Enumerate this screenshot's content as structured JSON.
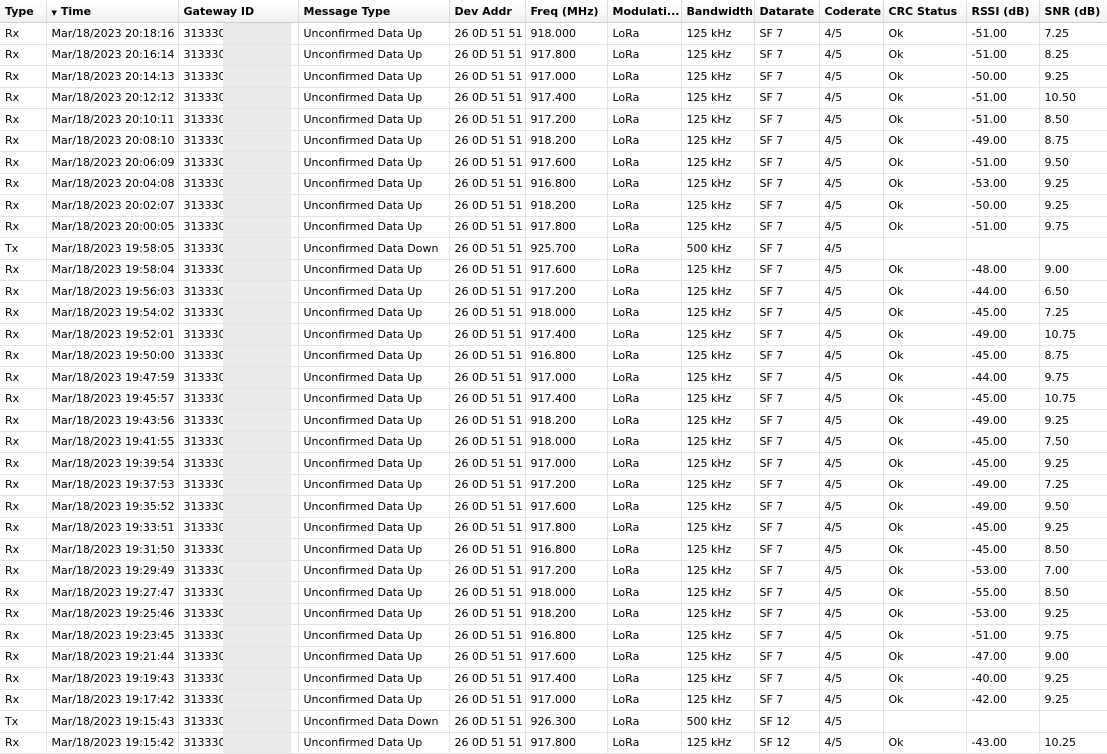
{
  "columns": [
    "Type",
    "Time",
    "Gateway ID",
    "Message Type",
    "Dev Addr",
    "Freq (MHz)",
    "Modulati...",
    "Bandwidth",
    "Datarate",
    "Coderate",
    "CRC Status",
    "RSSI (dB)",
    "SNR (dB)"
  ],
  "sort_indicator": "▼",
  "rows": [
    [
      "Rx",
      "Mar/18/2023 20:18:16",
      "313330",
      "Unconfirmed Data Up",
      "26 0D 51 51",
      "918.000",
      "LoRa",
      "125 kHz",
      "SF 7",
      "4/5",
      "Ok",
      "-51.00",
      "7.25"
    ],
    [
      "Rx",
      "Mar/18/2023 20:16:14",
      "313330",
      "Unconfirmed Data Up",
      "26 0D 51 51",
      "917.800",
      "LoRa",
      "125 kHz",
      "SF 7",
      "4/5",
      "Ok",
      "-51.00",
      "8.25"
    ],
    [
      "Rx",
      "Mar/18/2023 20:14:13",
      "313330",
      "Unconfirmed Data Up",
      "26 0D 51 51",
      "917.000",
      "LoRa",
      "125 kHz",
      "SF 7",
      "4/5",
      "Ok",
      "-50.00",
      "9.25"
    ],
    [
      "Rx",
      "Mar/18/2023 20:12:12",
      "313330",
      "Unconfirmed Data Up",
      "26 0D 51 51",
      "917.400",
      "LoRa",
      "125 kHz",
      "SF 7",
      "4/5",
      "Ok",
      "-51.00",
      "10.50"
    ],
    [
      "Rx",
      "Mar/18/2023 20:10:11",
      "313330",
      "Unconfirmed Data Up",
      "26 0D 51 51",
      "917.200",
      "LoRa",
      "125 kHz",
      "SF 7",
      "4/5",
      "Ok",
      "-51.00",
      "8.50"
    ],
    [
      "Rx",
      "Mar/18/2023 20:08:10",
      "313330",
      "Unconfirmed Data Up",
      "26 0D 51 51",
      "918.200",
      "LoRa",
      "125 kHz",
      "SF 7",
      "4/5",
      "Ok",
      "-49.00",
      "8.75"
    ],
    [
      "Rx",
      "Mar/18/2023 20:06:09",
      "313330",
      "Unconfirmed Data Up",
      "26 0D 51 51",
      "917.600",
      "LoRa",
      "125 kHz",
      "SF 7",
      "4/5",
      "Ok",
      "-51.00",
      "9.50"
    ],
    [
      "Rx",
      "Mar/18/2023 20:04:08",
      "313330",
      "Unconfirmed Data Up",
      "26 0D 51 51",
      "916.800",
      "LoRa",
      "125 kHz",
      "SF 7",
      "4/5",
      "Ok",
      "-53.00",
      "9.25"
    ],
    [
      "Rx",
      "Mar/18/2023 20:02:07",
      "313330",
      "Unconfirmed Data Up",
      "26 0D 51 51",
      "918.200",
      "LoRa",
      "125 kHz",
      "SF 7",
      "4/5",
      "Ok",
      "-50.00",
      "9.25"
    ],
    [
      "Rx",
      "Mar/18/2023 20:00:05",
      "313330",
      "Unconfirmed Data Up",
      "26 0D 51 51",
      "917.800",
      "LoRa",
      "125 kHz",
      "SF 7",
      "4/5",
      "Ok",
      "-51.00",
      "9.75"
    ],
    [
      "Tx",
      "Mar/18/2023 19:58:05",
      "313330",
      "Unconfirmed Data Down",
      "26 0D 51 51",
      "925.700",
      "LoRa",
      "500 kHz",
      "SF 7",
      "4/5",
      "",
      "",
      ""
    ],
    [
      "Rx",
      "Mar/18/2023 19:58:04",
      "313330",
      "Unconfirmed Data Up",
      "26 0D 51 51",
      "917.600",
      "LoRa",
      "125 kHz",
      "SF 7",
      "4/5",
      "Ok",
      "-48.00",
      "9.00"
    ],
    [
      "Rx",
      "Mar/18/2023 19:56:03",
      "313330",
      "Unconfirmed Data Up",
      "26 0D 51 51",
      "917.200",
      "LoRa",
      "125 kHz",
      "SF 7",
      "4/5",
      "Ok",
      "-44.00",
      "6.50"
    ],
    [
      "Rx",
      "Mar/18/2023 19:54:02",
      "313330",
      "Unconfirmed Data Up",
      "26 0D 51 51",
      "918.000",
      "LoRa",
      "125 kHz",
      "SF 7",
      "4/5",
      "Ok",
      "-45.00",
      "7.25"
    ],
    [
      "Rx",
      "Mar/18/2023 19:52:01",
      "313330",
      "Unconfirmed Data Up",
      "26 0D 51 51",
      "917.400",
      "LoRa",
      "125 kHz",
      "SF 7",
      "4/5",
      "Ok",
      "-49.00",
      "10.75"
    ],
    [
      "Rx",
      "Mar/18/2023 19:50:00",
      "313330",
      "Unconfirmed Data Up",
      "26 0D 51 51",
      "916.800",
      "LoRa",
      "125 kHz",
      "SF 7",
      "4/5",
      "Ok",
      "-45.00",
      "8.75"
    ],
    [
      "Rx",
      "Mar/18/2023 19:47:59",
      "313330",
      "Unconfirmed Data Up",
      "26 0D 51 51",
      "917.000",
      "LoRa",
      "125 kHz",
      "SF 7",
      "4/5",
      "Ok",
      "-44.00",
      "9.75"
    ],
    [
      "Rx",
      "Mar/18/2023 19:45:57",
      "313330",
      "Unconfirmed Data Up",
      "26 0D 51 51",
      "917.400",
      "LoRa",
      "125 kHz",
      "SF 7",
      "4/5",
      "Ok",
      "-45.00",
      "10.75"
    ],
    [
      "Rx",
      "Mar/18/2023 19:43:56",
      "313330",
      "Unconfirmed Data Up",
      "26 0D 51 51",
      "918.200",
      "LoRa",
      "125 kHz",
      "SF 7",
      "4/5",
      "Ok",
      "-49.00",
      "9.25"
    ],
    [
      "Rx",
      "Mar/18/2023 19:41:55",
      "313330",
      "Unconfirmed Data Up",
      "26 0D 51 51",
      "918.000",
      "LoRa",
      "125 kHz",
      "SF 7",
      "4/5",
      "Ok",
      "-45.00",
      "7.50"
    ],
    [
      "Rx",
      "Mar/18/2023 19:39:54",
      "313330",
      "Unconfirmed Data Up",
      "26 0D 51 51",
      "917.000",
      "LoRa",
      "125 kHz",
      "SF 7",
      "4/5",
      "Ok",
      "-45.00",
      "9.25"
    ],
    [
      "Rx",
      "Mar/18/2023 19:37:53",
      "313330",
      "Unconfirmed Data Up",
      "26 0D 51 51",
      "917.200",
      "LoRa",
      "125 kHz",
      "SF 7",
      "4/5",
      "Ok",
      "-49.00",
      "7.25"
    ],
    [
      "Rx",
      "Mar/18/2023 19:35:52",
      "313330",
      "Unconfirmed Data Up",
      "26 0D 51 51",
      "917.600",
      "LoRa",
      "125 kHz",
      "SF 7",
      "4/5",
      "Ok",
      "-49.00",
      "9.50"
    ],
    [
      "Rx",
      "Mar/18/2023 19:33:51",
      "313330",
      "Unconfirmed Data Up",
      "26 0D 51 51",
      "917.800",
      "LoRa",
      "125 kHz",
      "SF 7",
      "4/5",
      "Ok",
      "-45.00",
      "9.25"
    ],
    [
      "Rx",
      "Mar/18/2023 19:31:50",
      "313330",
      "Unconfirmed Data Up",
      "26 0D 51 51",
      "916.800",
      "LoRa",
      "125 kHz",
      "SF 7",
      "4/5",
      "Ok",
      "-45.00",
      "8.50"
    ],
    [
      "Rx",
      "Mar/18/2023 19:29:49",
      "313330",
      "Unconfirmed Data Up",
      "26 0D 51 51",
      "917.200",
      "LoRa",
      "125 kHz",
      "SF 7",
      "4/5",
      "Ok",
      "-53.00",
      "7.00"
    ],
    [
      "Rx",
      "Mar/18/2023 19:27:47",
      "313330",
      "Unconfirmed Data Up",
      "26 0D 51 51",
      "918.000",
      "LoRa",
      "125 kHz",
      "SF 7",
      "4/5",
      "Ok",
      "-55.00",
      "8.50"
    ],
    [
      "Rx",
      "Mar/18/2023 19:25:46",
      "313330",
      "Unconfirmed Data Up",
      "26 0D 51 51",
      "918.200",
      "LoRa",
      "125 kHz",
      "SF 7",
      "4/5",
      "Ok",
      "-53.00",
      "9.25"
    ],
    [
      "Rx",
      "Mar/18/2023 19:23:45",
      "313330",
      "Unconfirmed Data Up",
      "26 0D 51 51",
      "916.800",
      "LoRa",
      "125 kHz",
      "SF 7",
      "4/5",
      "Ok",
      "-51.00",
      "9.75"
    ],
    [
      "Rx",
      "Mar/18/2023 19:21:44",
      "313330",
      "Unconfirmed Data Up",
      "26 0D 51 51",
      "917.600",
      "LoRa",
      "125 kHz",
      "SF 7",
      "4/5",
      "Ok",
      "-47.00",
      "9.00"
    ],
    [
      "Rx",
      "Mar/18/2023 19:19:43",
      "313330",
      "Unconfirmed Data Up",
      "26 0D 51 51",
      "917.400",
      "LoRa",
      "125 kHz",
      "SF 7",
      "4/5",
      "Ok",
      "-40.00",
      "9.25"
    ],
    [
      "Rx",
      "Mar/18/2023 19:17:42",
      "313330",
      "Unconfirmed Data Up",
      "26 0D 51 51",
      "917.000",
      "LoRa",
      "125 kHz",
      "SF 7",
      "4/5",
      "Ok",
      "-42.00",
      "9.25"
    ],
    [
      "Tx",
      "Mar/18/2023 19:15:43",
      "313330",
      "Unconfirmed Data Down",
      "26 0D 51 51",
      "926.300",
      "LoRa",
      "500 kHz",
      "SF 12",
      "4/5",
      "",
      "",
      ""
    ],
    [
      "Rx",
      "Mar/18/2023 19:15:42",
      "313330",
      "Unconfirmed Data Up",
      "26 0D 51 51",
      "917.800",
      "LoRa",
      "125 kHz",
      "SF 12",
      "4/5",
      "Ok",
      "-43.00",
      "10.25"
    ]
  ]
}
